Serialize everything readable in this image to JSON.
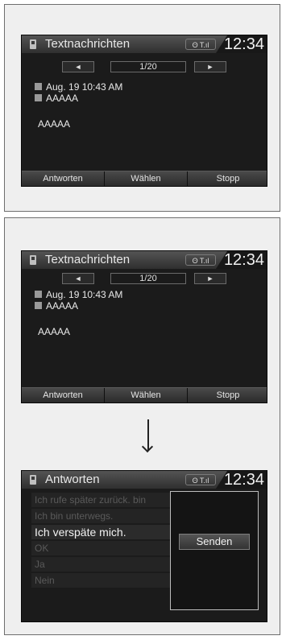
{
  "screen1": {
    "title": "Textnachrichten",
    "time": "12:34",
    "status_icons": "ʘ T.ıl",
    "prev_arrow": "◄",
    "next_arrow": "►",
    "page": "1/20",
    "date": "Aug. 19 10:43 AM",
    "sender": "AAAAA",
    "body": "AAAAA",
    "actions": [
      "Antworten",
      "Wählen",
      "Stopp"
    ]
  },
  "screen2": {
    "title": "Textnachrichten",
    "time": "12:34",
    "status_icons": "ʘ T.ıl",
    "prev_arrow": "◄",
    "next_arrow": "►",
    "page": "1/20",
    "date": "Aug. 19 10:43 AM",
    "sender": "AAAAA",
    "body": "AAAAA",
    "actions": [
      "Antworten",
      "Wählen",
      "Stopp"
    ]
  },
  "screen3": {
    "title": "Antworten",
    "time": "12:34",
    "status_icons": "ʘ T.ıl",
    "replies": [
      "Ich rufe später zurück. bin",
      "Ich bin unterwegs.",
      "Ich verspäte mich.",
      "OK",
      "Ja",
      "Nein"
    ],
    "send_label": "Senden"
  }
}
